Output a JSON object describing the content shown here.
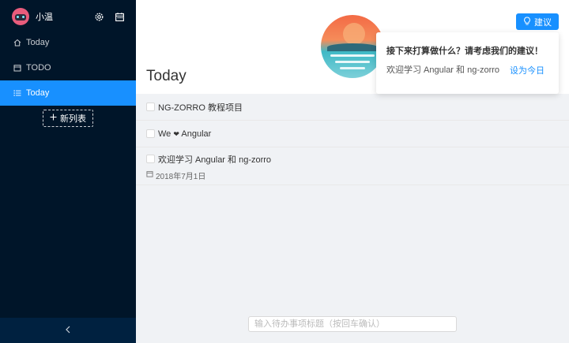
{
  "sidebar": {
    "username": "小温",
    "menu": [
      {
        "label": "Today",
        "icon": "home-icon",
        "active": false
      },
      {
        "label": "TODO",
        "icon": "calendar-icon",
        "active": false
      },
      {
        "label": "Today",
        "icon": "list-icon",
        "active": true
      }
    ],
    "new_list_label": "新列表",
    "collapse_icon": "chevron-left-icon"
  },
  "main": {
    "title": "Today",
    "suggest_button_label": "建议",
    "popover": {
      "title": "接下来打算做什么？请考虑我们的建议！",
      "text": "欢迎学习 Angular 和 ng-zorro",
      "action": "设为今日"
    },
    "todos": [
      {
        "text": "NG-ZORRO 教程项目"
      },
      {
        "text_before": "We",
        "heart": "❤",
        "text_after": "Angular"
      },
      {
        "text": "欢迎学习 Angular 和 ng-zorro",
        "date": "2018年7月1日"
      }
    ],
    "input_placeholder": "输入待办事项标题（按回车确认）"
  },
  "colors": {
    "sidebar_bg": "#001529",
    "accent": "#1890ff"
  }
}
